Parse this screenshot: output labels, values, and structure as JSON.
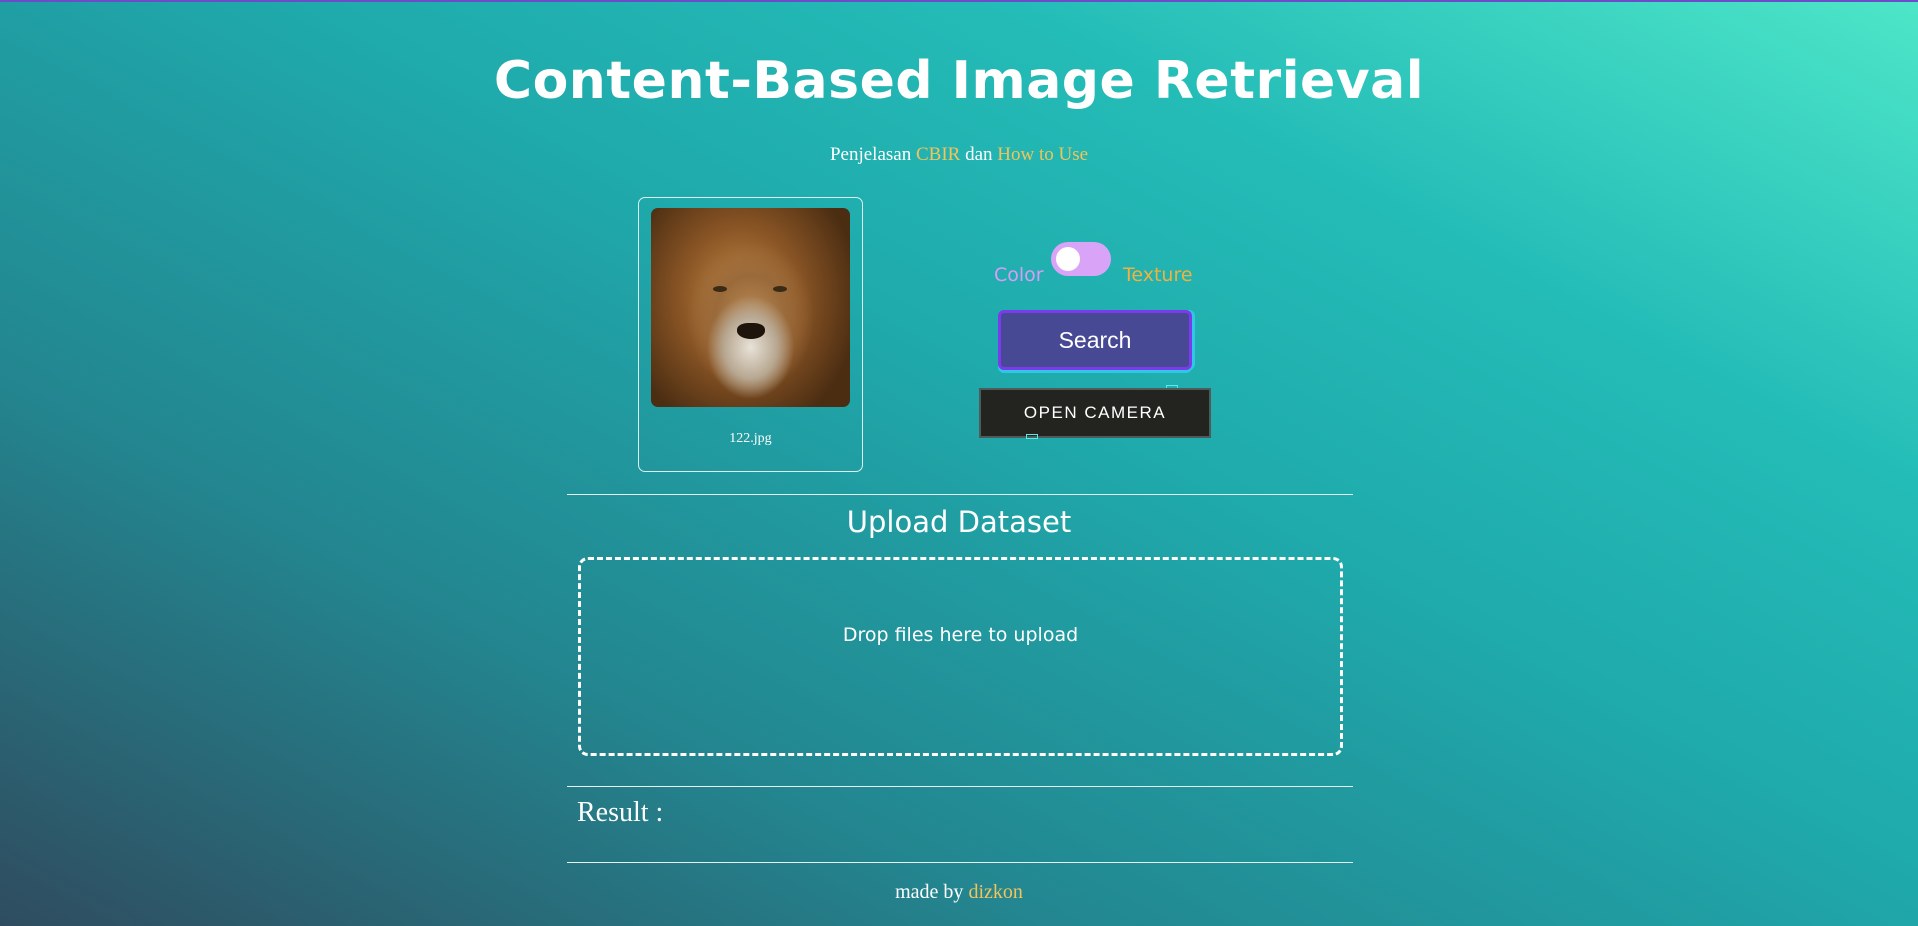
{
  "header": {
    "title": "Content-Based Image Retrieval",
    "intro_text": "Penjelasan",
    "cbir_link": "CBIR",
    "conjunction": "dan",
    "how_to_link": "How to Use"
  },
  "query": {
    "image_name": "122.jpg"
  },
  "controls": {
    "mode_left": "Color",
    "mode_right": "Texture",
    "toggle_selected": "Color",
    "search_label": "Search",
    "camera_label": "OPEN CAMERA"
  },
  "upload": {
    "title": "Upload Dataset",
    "dropzone_text": "Drop files here to upload"
  },
  "result": {
    "label": "Result :"
  },
  "footer": {
    "prefix": "made by",
    "author": "dizkon"
  },
  "colors": {
    "accent_link": "#f4c35a",
    "color_mode": "#d99cf7",
    "texture_mode": "#f0b23e",
    "search_button": "#484994",
    "camera_button": "#23241f"
  }
}
